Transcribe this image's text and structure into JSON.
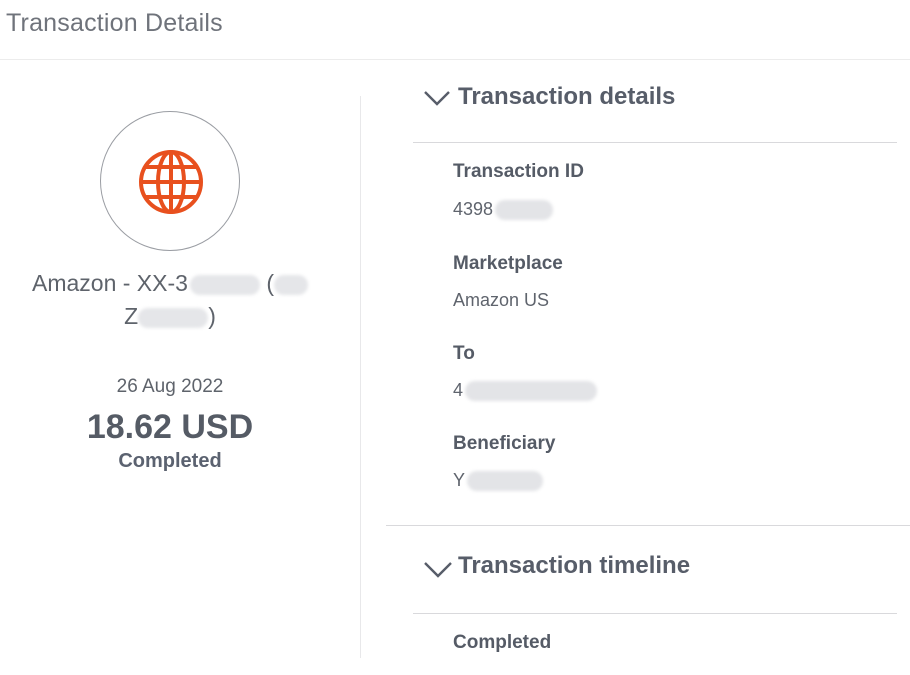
{
  "header": {
    "title": "Transaction Details"
  },
  "summary": {
    "icon": "globe-icon",
    "merchant_line1": "Amazon - XX-3",
    "merchant_line1_tail": "(",
    "merchant_line2_head": "Z",
    "merchant_line2_tail": ")",
    "date": "26 Aug 2022",
    "amount": "18.62 USD",
    "status": "Completed",
    "accent_color": "#e8501e"
  },
  "details_section": {
    "title": "Transaction details",
    "fields": [
      {
        "label": "Transaction ID",
        "value": "4398"
      },
      {
        "label": "Marketplace",
        "value": "Amazon US"
      },
      {
        "label": "To",
        "value": "4"
      },
      {
        "label": "Beneficiary",
        "value": "Y"
      }
    ]
  },
  "timeline_section": {
    "title": "Transaction timeline",
    "first_entry": "Completed"
  }
}
